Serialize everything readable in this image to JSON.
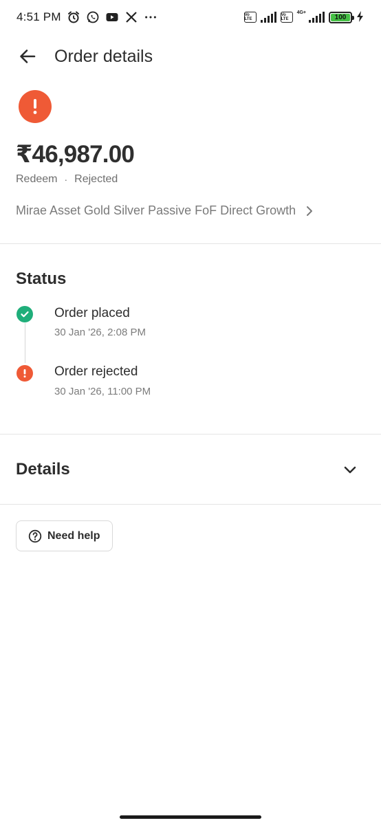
{
  "status_bar": {
    "time": "4:51 PM",
    "notification_icons": [
      "alarm-icon",
      "whatsapp-icon",
      "youtube-icon",
      "x-icon",
      "more-icon"
    ],
    "volte_label": "Vo LTE",
    "network_label": "4G+",
    "battery_level": "100",
    "battery_color": "#46c146"
  },
  "header": {
    "title": "Order details"
  },
  "summary": {
    "status_icon": "alert-icon",
    "status_color": "#ef5a36",
    "amount": "₹46,987.00",
    "type": "Redeem",
    "separator": "·",
    "status": "Rejected",
    "fund_name": "Mirae Asset Gold Silver Passive FoF Direct Growth"
  },
  "status_section": {
    "title": "Status",
    "steps": [
      {
        "title": "Order placed",
        "time": "30 Jan '26, 2:08 PM",
        "icon": "check-icon",
        "color": "#1fae7a"
      },
      {
        "title": "Order rejected",
        "time": "30 Jan '26, 11:00 PM",
        "icon": "alert-icon",
        "color": "#ef5a36"
      }
    ]
  },
  "details_section": {
    "title": "Details",
    "expand_icon": "chevron-down-icon"
  },
  "help": {
    "label": "Need help",
    "icon": "question-circle-icon"
  }
}
